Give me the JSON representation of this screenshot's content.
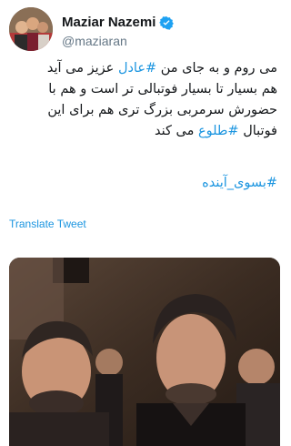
{
  "author": {
    "name": "Maziar Nazemi",
    "handle": "@maziaran",
    "verified": true,
    "avatar_icon": "profile-photo"
  },
  "tweet": {
    "lines": [
      [
        "",
        "می روم و به جای من ",
        "#عادل",
        " عزیز می آید"
      ],
      [
        "",
        "هم بسیار تا بسیار فوتبالی تر است و هم با",
        "",
        ""
      ],
      [
        "",
        "حضورش سرمربی بزرگ تری هم برای این",
        "",
        ""
      ],
      [
        "",
        "فوتبال ",
        "#طلوع",
        " می کند"
      ]
    ],
    "hashtag_line": "#بسوی_آینده",
    "translate_label": "Translate Tweet"
  },
  "colors": {
    "link": "#1b95e0",
    "verified_badge": "#1da1f2",
    "handle": "#657786"
  },
  "media": {
    "type": "photo",
    "description_icon": "selfie-photo"
  }
}
